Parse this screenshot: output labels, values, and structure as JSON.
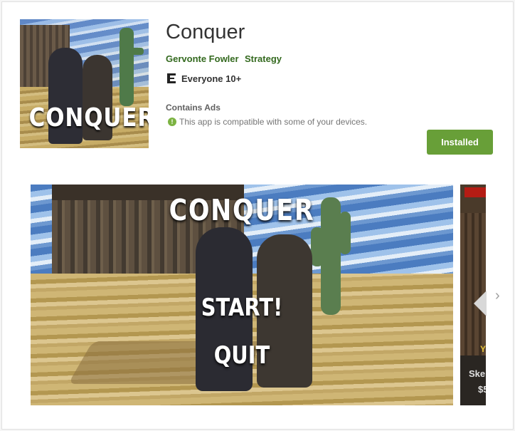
{
  "app": {
    "icon_text": "CONQUER",
    "title": "Conquer",
    "developer": "Gervonte Fowler",
    "category": "Strategy",
    "content_rating": "Everyone 10+",
    "contains_ads": "Contains Ads",
    "compatibility": "This app is compatible with some of your devices.",
    "install_button": "Installed"
  },
  "colors": {
    "accent_green": "#689f38",
    "link_green": "#33691e",
    "info_icon_green": "#7cb342"
  },
  "screenshots": {
    "first": {
      "title": "CONQUER",
      "menu_start": "START!",
      "menu_quit": "QUIT"
    },
    "second": {
      "partial_yellow_text": "Y",
      "partial_label": "Ske",
      "partial_price": "$5"
    }
  },
  "icons": {
    "rating": "esrb-rating-icon",
    "info": "info-icon",
    "next": "chevron-right-icon",
    "prev": "chevron-left-icon"
  }
}
